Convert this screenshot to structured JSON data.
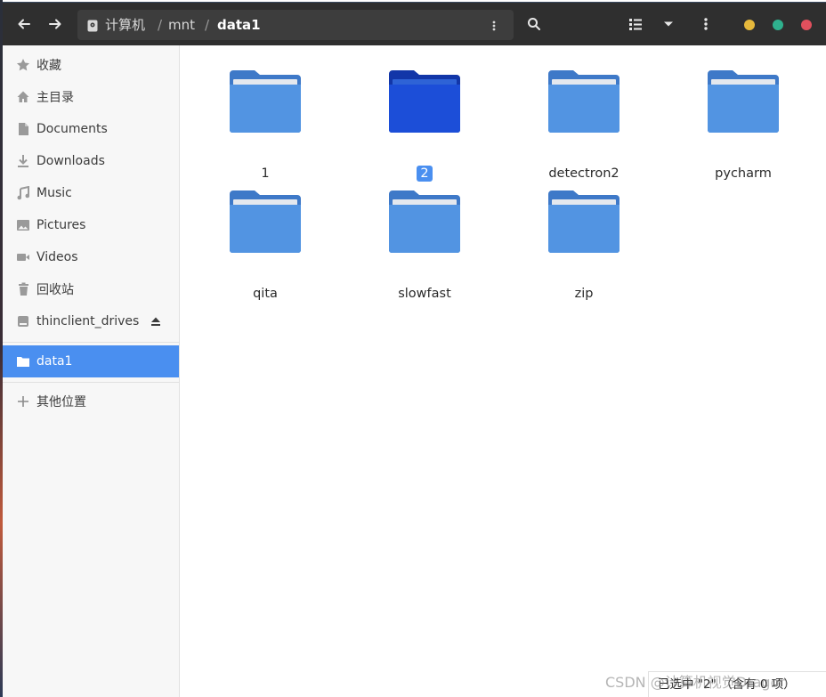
{
  "header": {
    "breadcrumbs": [
      "计算机",
      "mnt",
      "data1"
    ],
    "separator": "/"
  },
  "sidebar": {
    "places": [
      {
        "label": "收藏",
        "icon": "star-icon"
      },
      {
        "label": "主目录",
        "icon": "home-icon"
      },
      {
        "label": "Documents",
        "icon": "document-icon"
      },
      {
        "label": "Downloads",
        "icon": "download-icon"
      },
      {
        "label": "Music",
        "icon": "music-icon"
      },
      {
        "label": "Pictures",
        "icon": "picture-icon"
      },
      {
        "label": "Videos",
        "icon": "video-icon"
      },
      {
        "label": "回收站",
        "icon": "trash-icon"
      },
      {
        "label": "thinclient_drives",
        "icon": "drive-icon"
      }
    ],
    "bookmarks": [
      {
        "label": "data1",
        "icon": "folder-icon",
        "active": true
      }
    ],
    "other": {
      "label": "其他位置",
      "icon": "plus-icon"
    }
  },
  "files": [
    {
      "name": "1",
      "selected": false
    },
    {
      "name": "2",
      "selected": true
    },
    {
      "name": "detectron2",
      "selected": false
    },
    {
      "name": "pycharm",
      "selected": false
    },
    {
      "name": "qita",
      "selected": false
    },
    {
      "name": "slowfast",
      "selected": false
    },
    {
      "name": "zip",
      "selected": false
    }
  ],
  "status": {
    "text": "已选中 \"2\" （含有 0 项）"
  },
  "watermark": "CSDN @计算机视觉Dragon",
  "colors": {
    "folder": "#5294e2",
    "folder_selected": "#1c4ed8",
    "accent": "#4a8ff0",
    "dot_yellow": "#e6b93c",
    "dot_green": "#2fb18e",
    "dot_red": "#e0505d"
  }
}
